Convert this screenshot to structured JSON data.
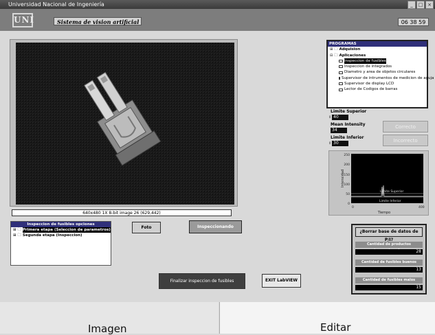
{
  "window": {
    "title": "Universidad Nacional de Ingeniería",
    "buttons": [
      "_",
      "□",
      "×"
    ]
  },
  "header": {
    "logo_text": "UNI",
    "app_title": "Sistema de vision artificial",
    "clock": "06 38 59"
  },
  "image_panel": {
    "status": "640x480 1X 8-bit image 26   (629,442)"
  },
  "programas": {
    "header": "PROGRAMAS",
    "items": [
      {
        "label": "Adquision",
        "level": 0,
        "type": "folder"
      },
      {
        "label": "Aplicaciones",
        "level": 0,
        "type": "folder"
      },
      {
        "label": "Inspeccion de fusibles",
        "level": 1,
        "type": "item",
        "selected": true
      },
      {
        "label": "Inspeccion de integrados",
        "level": 1,
        "type": "item"
      },
      {
        "label": "Diametro y area de objetos circulares",
        "level": 1,
        "type": "item"
      },
      {
        "label": "Supervisor de intrumentos de medicion de aguja",
        "level": 1,
        "type": "item"
      },
      {
        "label": "Supervisor de display LCD",
        "level": 1,
        "type": "item"
      },
      {
        "label": "Lector de Codigos de barras",
        "level": 1,
        "type": "item"
      }
    ]
  },
  "limits": {
    "superior_label": "Limite Superior",
    "superior_value": "40",
    "mean_label": "Mean Intensity",
    "mean_value": "34",
    "inferior_label": "Limite Inferior",
    "inferior_value": "30"
  },
  "status_buttons": {
    "correcto": "Correcto",
    "no_correcto": "Incorrecto"
  },
  "graph": {
    "ylabel": "Intensidad",
    "xlabel": "Tiempo",
    "yticks": [
      "250",
      "200",
      "150",
      "100",
      "50",
      "0"
    ],
    "xticks": [
      "0",
      "400"
    ],
    "sup_label": "Limite Superior",
    "inf_label": "Limite Inferior"
  },
  "options": {
    "header": "Inspeccion de fusibles opciones",
    "items": [
      {
        "label": "Primera etapa (Seleccion de parametros)",
        "selected": true
      },
      {
        "label": "Segunda etapa (Inspeccion)",
        "selected": false
      }
    ]
  },
  "buttons": {
    "foto": "Foto",
    "inspeccionando": "Inspeccionando",
    "finalizar": "Finalizar inspeccion de fusibles",
    "exit": "EXIT LabVIEW"
  },
  "counters": {
    "borrar": "¿Borrar base de datos de P/I?",
    "rows": [
      {
        "label": "Cantidad de productos inspeccionados",
        "value": "28"
      },
      {
        "label": "Cantidad de fusibles buenos",
        "value": "13"
      },
      {
        "label": "Cantidad de fusibles malos",
        "value": "15"
      }
    ]
  },
  "tabs": {
    "left": "Imagen",
    "right": "Editar"
  }
}
